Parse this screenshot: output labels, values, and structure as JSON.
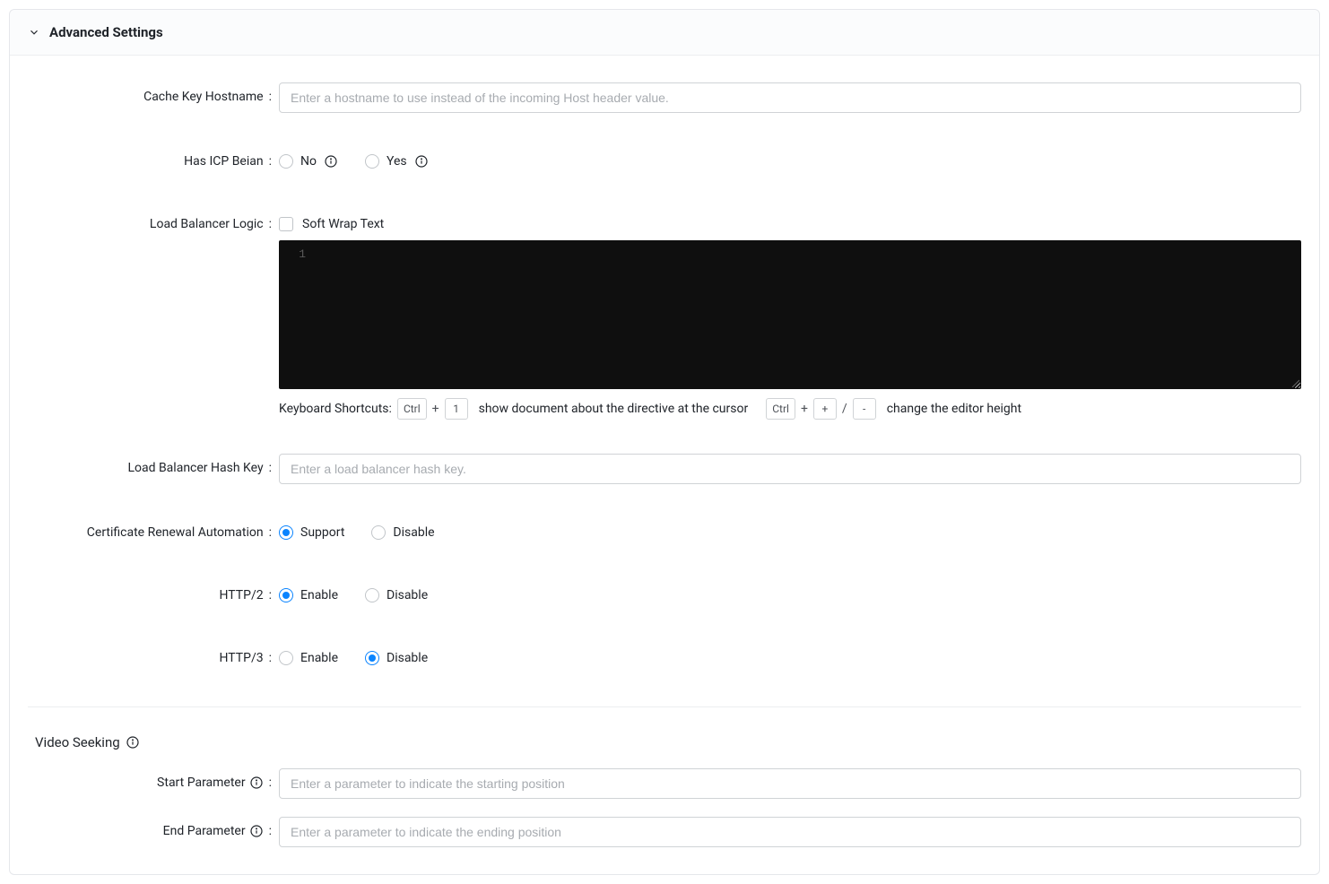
{
  "panel": {
    "title": "Advanced Settings"
  },
  "fields": {
    "cache_key_hostname": {
      "label": "Cache Key Hostname",
      "placeholder": "Enter a hostname to use instead of the incoming Host header value.",
      "value": ""
    },
    "icp_beian": {
      "label": "Has ICP Beian",
      "option_no": "No",
      "option_yes": "Yes",
      "selected": ""
    },
    "load_balancer_logic": {
      "label": "Load Balancer Logic",
      "soft_wrap_label": "Soft Wrap Text",
      "soft_wrap_checked": false,
      "editor_line": "1",
      "shortcuts_label": "Keyboard Shortcuts:",
      "key_ctrl": "Ctrl",
      "key_1": "1",
      "sep_plus": "+",
      "sep_slash": "/",
      "key_plus": "+",
      "key_minus": "-",
      "hint_1": "show document about the directive at the cursor",
      "hint_2": "change the editor height"
    },
    "load_balancer_hash_key": {
      "label": "Load Balancer Hash Key",
      "placeholder": "Enter a load balancer hash key.",
      "value": ""
    },
    "cert_renewal": {
      "label": "Certificate Renewal Automation",
      "option_support": "Support",
      "option_disable": "Disable",
      "selected": "support"
    },
    "http2": {
      "label": "HTTP/2",
      "option_enable": "Enable",
      "option_disable": "Disable",
      "selected": "enable"
    },
    "http3": {
      "label": "HTTP/3",
      "option_enable": "Enable",
      "option_disable": "Disable",
      "selected": "disable"
    }
  },
  "video_seeking": {
    "title": "Video Seeking",
    "start": {
      "label": "Start Parameter",
      "placeholder": "Enter a parameter to indicate the starting position",
      "value": ""
    },
    "end": {
      "label": "End Parameter",
      "placeholder": "Enter a parameter to indicate the ending position",
      "value": ""
    }
  }
}
